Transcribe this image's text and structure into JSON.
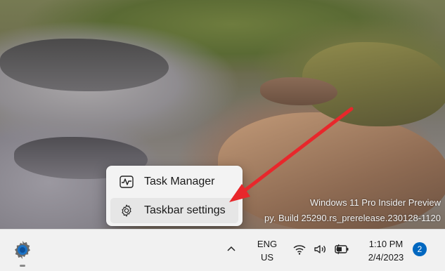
{
  "context_menu": {
    "items": [
      {
        "label": "Task Manager",
        "icon": "task-manager-icon"
      },
      {
        "label": "Taskbar settings",
        "icon": "gear-icon"
      }
    ]
  },
  "watermark": {
    "line1": "Windows 11 Pro Insider Preview",
    "line2": "py. Build 25290.rs_prerelease.230128-1120"
  },
  "taskbar": {
    "start_icon": "settings-app-icon",
    "overflow_icon": "chevron-up-icon",
    "language": {
      "line1": "ENG",
      "line2": "US"
    },
    "system_icons": [
      "wifi-icon",
      "volume-icon",
      "battery-icon"
    ],
    "time": "1:10 PM",
    "date": "2/4/2023",
    "notification_count": "2"
  },
  "colors": {
    "arrow": "#e8272b",
    "accent": "#0067c0",
    "menu_bg": "#f3f3f3",
    "taskbar_bg": "#f1f1f1"
  }
}
